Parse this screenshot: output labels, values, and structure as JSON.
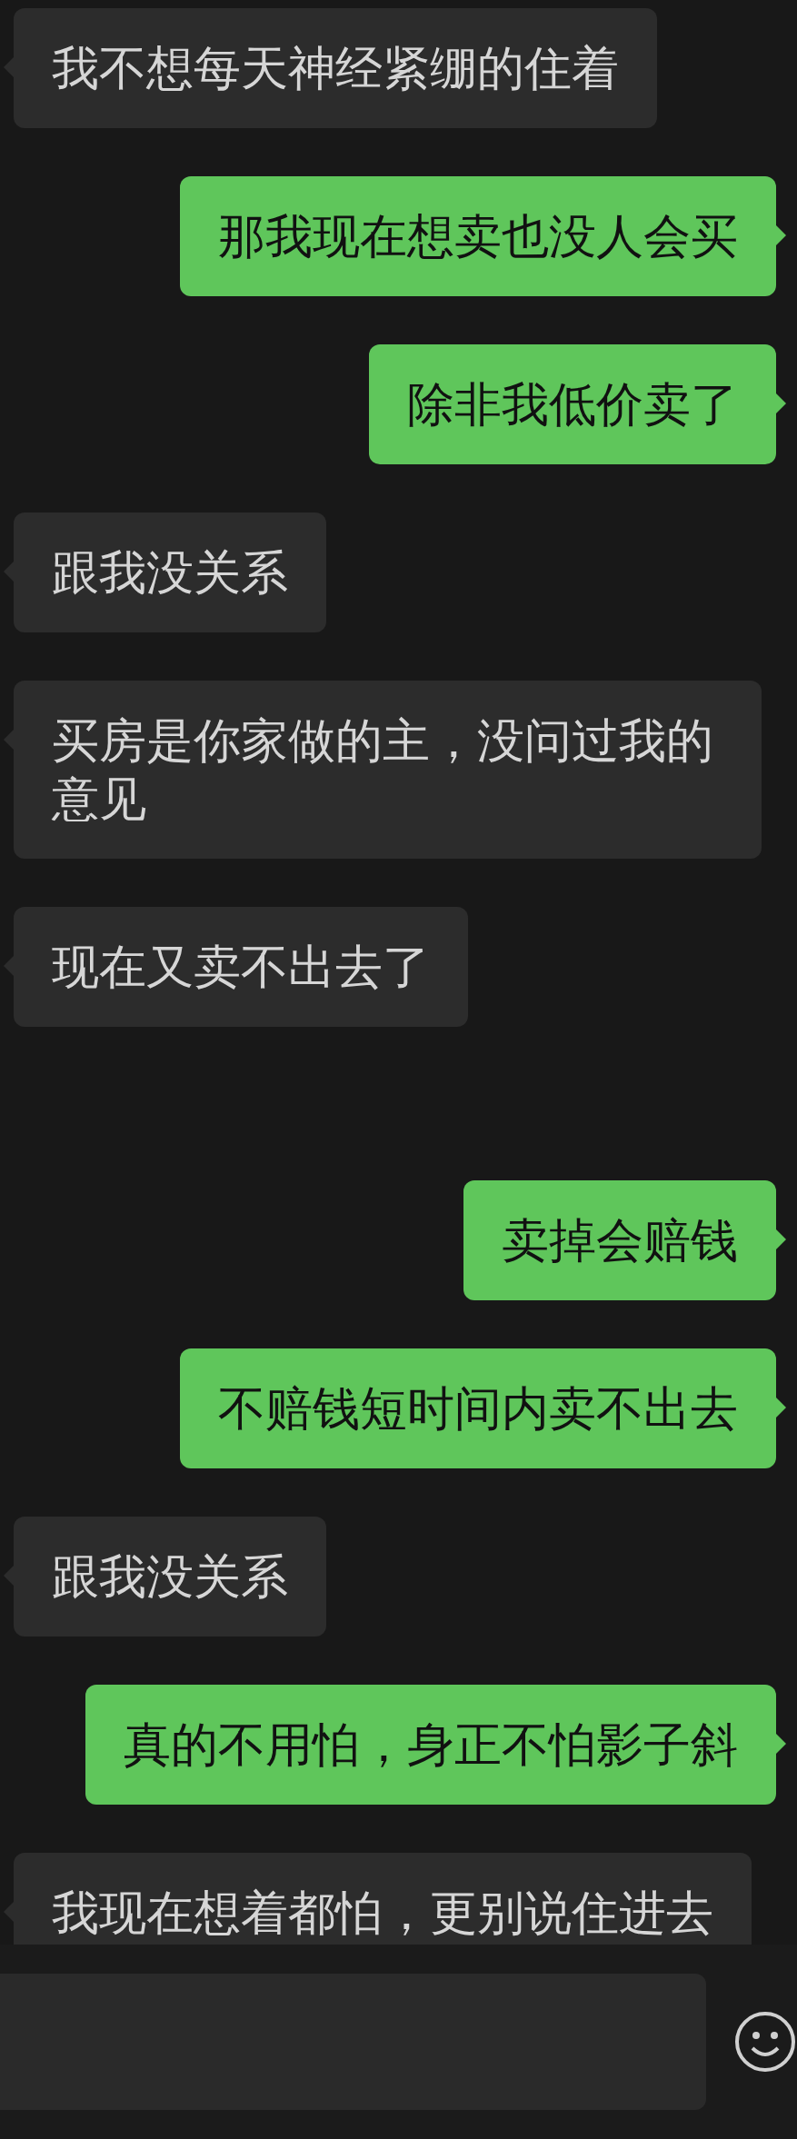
{
  "messages": [
    {
      "kind": "received",
      "text": "我不想每天神经紧绷的住着"
    },
    {
      "kind": "sent",
      "text": "那我现在想卖也没人会买"
    },
    {
      "kind": "sent",
      "text": "除非我低价卖了"
    },
    {
      "kind": "received",
      "text": "跟我没关系"
    },
    {
      "kind": "received",
      "text": "买房是你家做的主，没问过我的意见"
    },
    {
      "kind": "received",
      "text": "现在又卖不出去了"
    },
    {
      "kind": "sent",
      "text": "卖掉会赔钱"
    },
    {
      "kind": "sent",
      "text": "不赔钱短时间内卖不出去"
    },
    {
      "kind": "received",
      "text": "跟我没关系"
    },
    {
      "kind": "sent",
      "text": "真的不用怕，身正不怕影子斜"
    },
    {
      "kind": "received",
      "text": "我现在想着都怕，更别说住进去"
    }
  ]
}
